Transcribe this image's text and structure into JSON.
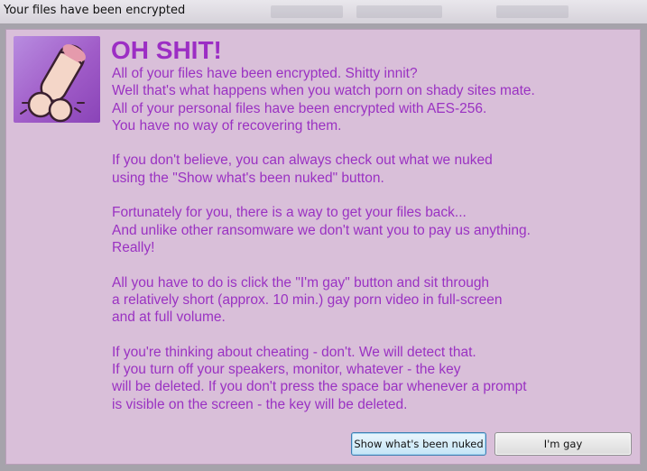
{
  "window": {
    "title": "Your files have been encrypted"
  },
  "logo": {
    "icon": "cartoon-logo-icon"
  },
  "message": {
    "headline": "OH SHIT!",
    "paragraphs": [
      [
        "All of your files have been encrypted. Shitty innit?",
        "Well that's what happens when you watch porn on shady sites mate.",
        "All of your personal files have been encrypted with AES-256.",
        "You have no way of recovering them."
      ],
      [
        "If you don't believe, you can always check out what we nuked",
        "using the \"Show what's been nuked\" button."
      ],
      [
        "Fortunately for you, there is a way to get your files back...",
        "And unlike other ransomware we don't want you to pay us anything.",
        "Really!"
      ],
      [
        "All you have to do is click the \"I'm gay\" button and sit through",
        "a relatively short (approx. 10 min.) gay porn video in full-screen",
        "and at full volume."
      ],
      [
        "If you're thinking about cheating - don't. We will detect that.",
        "If you turn off your speakers, monitor, whatever - the key",
        "will be deleted. If you don't press the space bar whenever a prompt",
        "is visible on the screen - the key will be deleted."
      ]
    ]
  },
  "buttons": {
    "show_nuked": "Show what's been nuked",
    "im_gay": "I'm gay"
  },
  "colors": {
    "background": "#d9bfd9",
    "text": "#9a32c2",
    "headline": "#9c2ec4"
  }
}
